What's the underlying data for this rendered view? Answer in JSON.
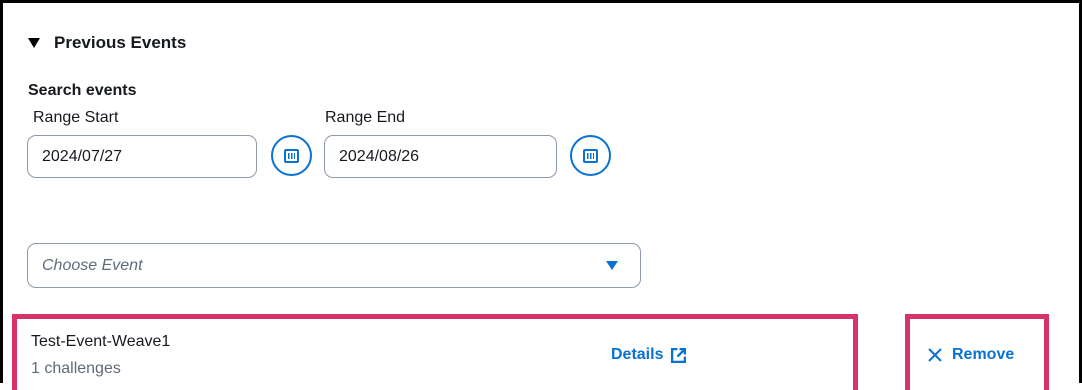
{
  "section": {
    "title": "Previous Events",
    "toggle_icon": "caret-down-icon"
  },
  "search": {
    "title": "Search events",
    "range_start": {
      "label": "Range Start",
      "value": "2024/07/27",
      "icon": "calendar-icon"
    },
    "range_end": {
      "label": "Range End",
      "value": "2024/08/26",
      "icon": "calendar-icon"
    }
  },
  "event_select": {
    "placeholder": "Choose Event",
    "icon": "caret-down-icon"
  },
  "selected_event": {
    "name": "Test-Event-Weave1",
    "subtitle": "1 challenges",
    "details_label": "Details",
    "details_icon": "external-link-icon",
    "remove_label": "Remove",
    "remove_icon": "close-icon"
  },
  "colors": {
    "accent": "#0972d3",
    "highlight_border": "#d6336c",
    "input_border": "#8d99a8",
    "muted_text": "#5f6b7a"
  }
}
